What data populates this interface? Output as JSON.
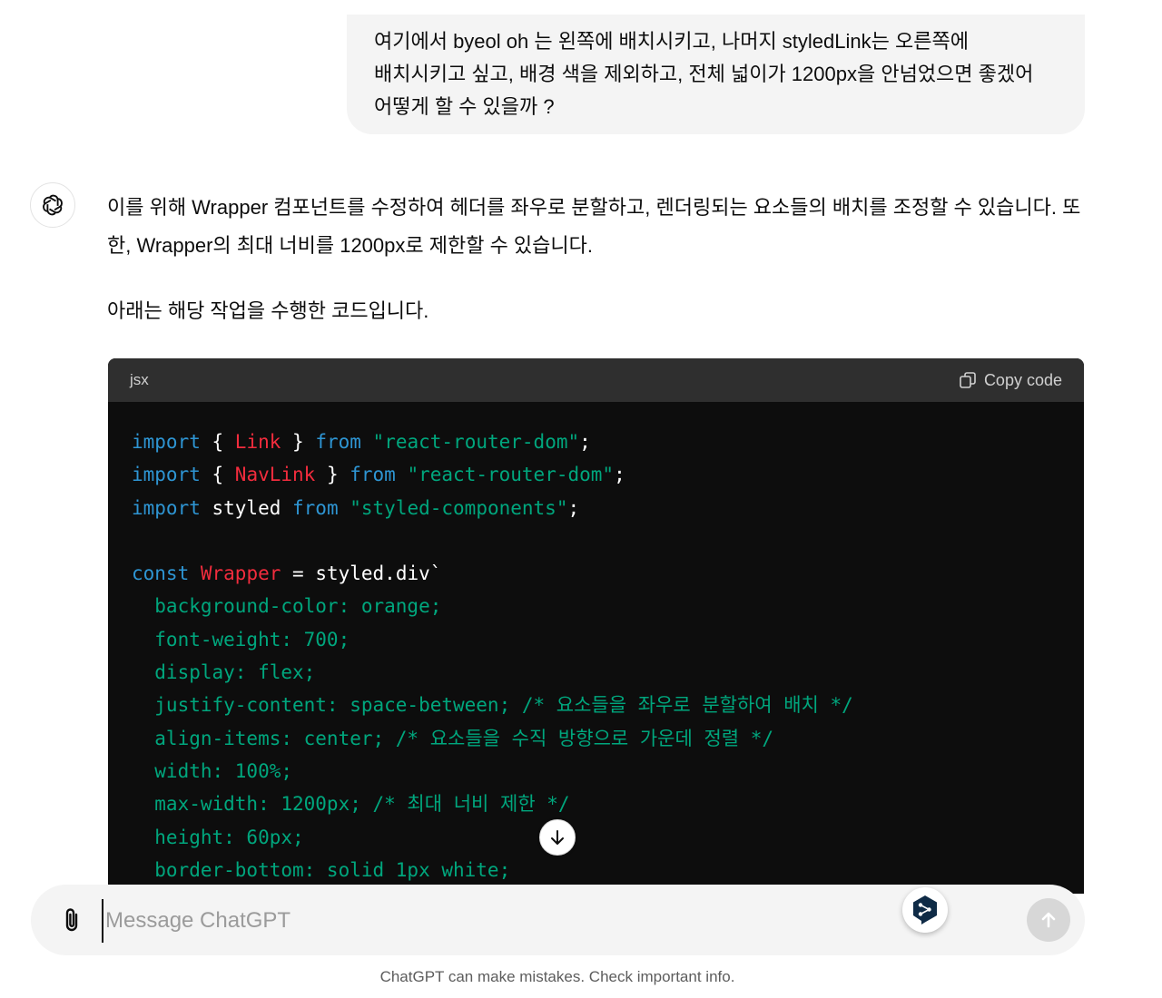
{
  "user_message": {
    "text": "여기에서 byeol oh 는 왼쪽에 배치시키고, 나머지 styledLink는 오른쪽에 배치시키고 싶고, 배경 색을 제외하고, 전체 넓이가 1200px을 안넘었으면 좋겠어 어떻게 할 수 있을까 ?"
  },
  "assistant": {
    "avatar_icon": "openai-logo-icon",
    "paragraph_1": "이를 위해 Wrapper 컴포넌트를 수정하여 헤더를 좌우로 분할하고, 렌더링되는 요소들의 배치를 조정할 수 있습니다. 또한, Wrapper의 최대 너비를 1200px로 제한할 수 있습니다.",
    "paragraph_2": "아래는 해당 작업을 수행한 코드입니다."
  },
  "code_block": {
    "language": "jsx",
    "copy_label": "Copy code",
    "copy_icon": "copy-icon",
    "lines": [
      [
        [
          "import",
          "kw"
        ],
        [
          " { ",
          "white"
        ],
        [
          "Link",
          "red"
        ],
        [
          " } ",
          "white"
        ],
        [
          "from",
          "kw"
        ],
        [
          " ",
          "white"
        ],
        [
          "\"react-router-dom\"",
          "str"
        ],
        [
          ";",
          "white"
        ]
      ],
      [
        [
          "import",
          "kw"
        ],
        [
          " { ",
          "white"
        ],
        [
          "NavLink",
          "red"
        ],
        [
          " } ",
          "white"
        ],
        [
          "from",
          "kw"
        ],
        [
          " ",
          "white"
        ],
        [
          "\"react-router-dom\"",
          "str"
        ],
        [
          ";",
          "white"
        ]
      ],
      [
        [
          "import",
          "kw"
        ],
        [
          " styled ",
          "white"
        ],
        [
          "from",
          "kw"
        ],
        [
          " ",
          "white"
        ],
        [
          "\"styled-components\"",
          "str"
        ],
        [
          ";",
          "white"
        ]
      ],
      [],
      [
        [
          "const",
          "kw"
        ],
        [
          " ",
          "white"
        ],
        [
          "Wrapper",
          "red"
        ],
        [
          " = styled.div`",
          "white"
        ]
      ],
      [
        [
          "  background-color: orange;",
          "css"
        ]
      ],
      [
        [
          "  font-weight: 700;",
          "css"
        ]
      ],
      [
        [
          "  display: flex;",
          "css"
        ]
      ],
      [
        [
          "  justify-content: space-between; /* 요소들을 좌우로 분할하여 배치 */",
          "css"
        ]
      ],
      [
        [
          "  align-items: center; /* 요소들을 수직 방향으로 가운데 정렬 */",
          "css"
        ]
      ],
      [
        [
          "  width: 100%;",
          "css"
        ]
      ],
      [
        [
          "  max-width: 1200px; /* 최대 너비 제한 */",
          "css"
        ]
      ],
      [
        [
          "  height: 60px;",
          "css"
        ]
      ],
      [
        [
          "  border-bottom: solid 1px white;",
          "css"
        ]
      ]
    ]
  },
  "scroll_button_icon": "arrow-down-icon",
  "composer": {
    "placeholder": "Message ChatGPT",
    "value": "",
    "attach_icon": "paperclip-icon",
    "deepl_icon": "deepl-icon",
    "send_icon": "arrow-up-icon"
  },
  "disclaimer": "ChatGPT can make mistakes. Check important info."
}
